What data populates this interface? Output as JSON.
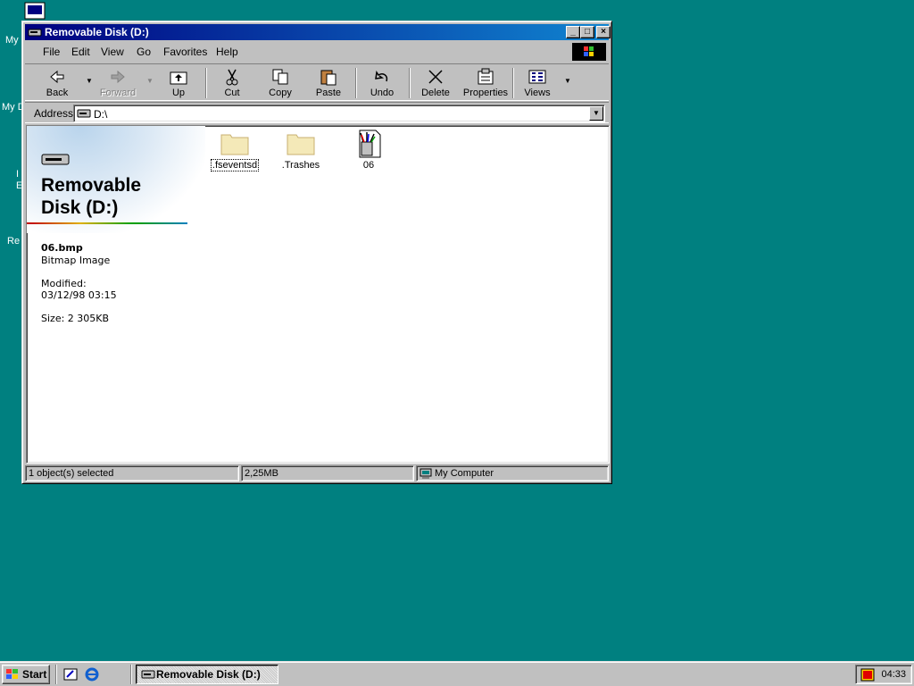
{
  "desktop": {
    "labels": [
      "My",
      "My D",
      "I",
      "E",
      "Re"
    ]
  },
  "window": {
    "title": "Removable Disk (D:)",
    "controls": {
      "minimize": "_",
      "maximize": "□",
      "close": "×"
    }
  },
  "menu": [
    {
      "label": "File"
    },
    {
      "label": "Edit"
    },
    {
      "label": "View"
    },
    {
      "label": "Go"
    },
    {
      "label": "Favorites"
    },
    {
      "label": "Help"
    }
  ],
  "toolbar": {
    "back": "Back",
    "forward": "Forward",
    "up": "Up",
    "cut": "Cut",
    "copy": "Copy",
    "paste": "Paste",
    "undo": "Undo",
    "delete": "Delete",
    "properties": "Properties",
    "views": "Views",
    "dropdown": "▼"
  },
  "address": {
    "label": "Address",
    "value": "D:\\",
    "dropdown": "▼"
  },
  "info": {
    "title_line1": "Removable",
    "title_line2": "Disk (D:)",
    "file_name": "06.bmp",
    "file_type": "Bitmap Image",
    "modified_label": "Modified:",
    "modified_value": "03/12/98 03:15",
    "size": "Size: 2 305KB"
  },
  "files": [
    {
      "name": ".fseventsd",
      "icon": "folder-icon"
    },
    {
      "name": ".Trashes",
      "icon": "folder-icon"
    },
    {
      "name": "06",
      "icon": "bitmap-file-icon"
    }
  ],
  "status": {
    "selection": "1 object(s) selected",
    "size": "2,25MB",
    "zone": "My Computer"
  },
  "taskbar": {
    "start": "Start",
    "task": "Removable Disk (D:)",
    "clock": "04:33"
  },
  "colors": {
    "desktop": "#008080",
    "title_active": "#000080",
    "face": "#c0c0c0"
  }
}
